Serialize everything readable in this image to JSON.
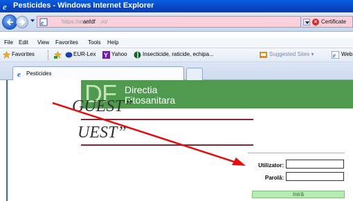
{
  "window": {
    "title": "Pesticides - Windows Internet Explorer"
  },
  "address_bar": {
    "url_prefix": "https://atoe.",
    "url_host": "anfdf",
    "url_rest": ".ro/",
    "certificate_label": "Certificate"
  },
  "menu": {
    "items": [
      "File",
      "Edit",
      "View",
      "Favorites",
      "Tools",
      "Help"
    ]
  },
  "favorites_bar": {
    "favorites_label": "Favorites",
    "links": [
      "EUR-Lex",
      "Yahoo",
      "Insecticide, raticide, echipa...",
      "Suggested Sites ▾",
      "Web"
    ]
  },
  "tab": {
    "label": "Pesticides"
  },
  "banner": {
    "logo": "DF",
    "line1": "Directia",
    "line2": "Fitosanitara"
  },
  "overlay": {
    "line1": "GUEST”",
    "line2": "UEST”"
  },
  "login": {
    "user_label": "Utilizator:",
    "password_label": "Parolă:",
    "user_value": "",
    "password_value": "",
    "submit_label": "Intră"
  },
  "colors": {
    "banner_green": "#4f9a4e",
    "annotation_arrow": "#e01010",
    "rule": "#8a2430"
  }
}
